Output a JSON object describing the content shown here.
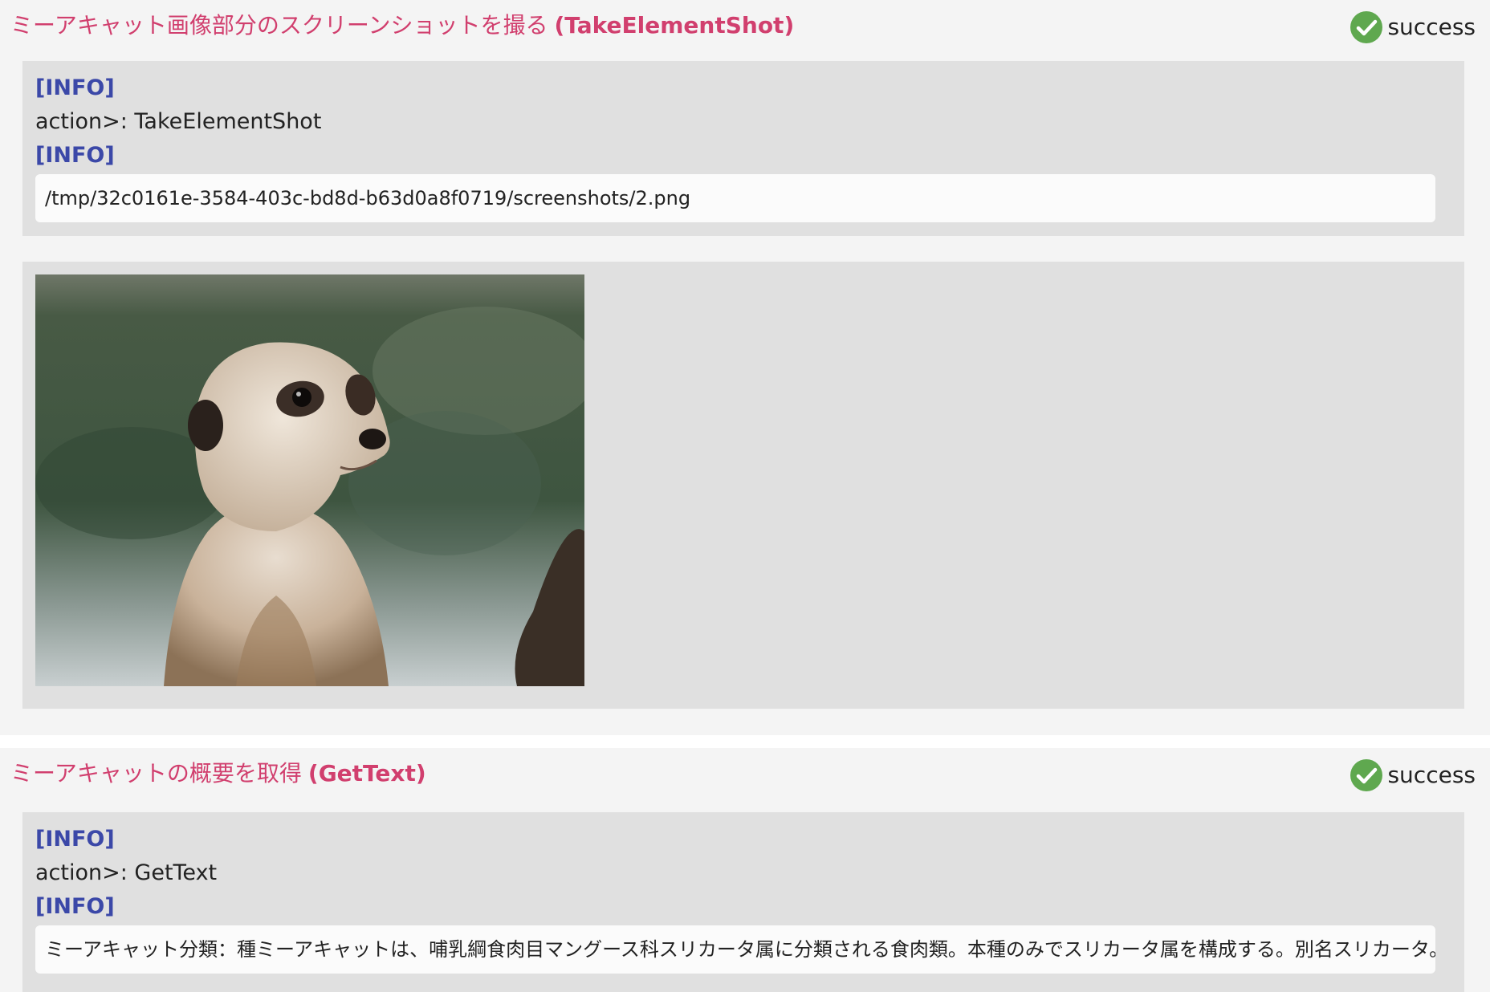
{
  "steps": [
    {
      "title_jp": "ミーアキャット画像部分のスクリーンショットを撮る",
      "title_code": "(TakeElementShot)",
      "status": "success",
      "log": {
        "tag1": "[INFO]",
        "action": "action>: TakeElementShot",
        "tag2": "[INFO]",
        "output": "/tmp/32c0161e-3584-403c-bd8d-b63d0a8f0719/screenshots/2.png"
      },
      "image": {
        "subject": "meerkat-photo"
      }
    },
    {
      "title_jp": "ミーアキャットの概要を取得",
      "title_code": "(GetText)",
      "status": "success",
      "log": {
        "tag1": "[INFO]",
        "action": "action>: GetText",
        "tag2": "[INFO]",
        "output": "ミーアキャット分類：種ミーアキャットは、哺乳綱食肉目マングース科スリカータ属に分類される食肉類。本種のみでスリカータ属を構成する。別名スリカータ。ミーアカット。Wikip"
      }
    }
  ],
  "colors": {
    "title": "#d13f6e",
    "tag": "#3b48a8",
    "success": "#5fa84f",
    "panel": "#e0e0e0",
    "background": "#f4f4f4"
  },
  "icons": {
    "status": "check-circle-icon"
  }
}
